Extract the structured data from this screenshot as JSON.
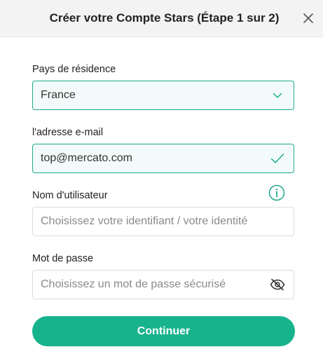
{
  "header": {
    "title": "Créer votre Compte Stars (Étape 1 sur 2)"
  },
  "form": {
    "country": {
      "label": "Pays de résidence",
      "value": "France"
    },
    "email": {
      "label": "l'adresse e-mail",
      "value": "top@mercato.com"
    },
    "username": {
      "label": "Nom d'utilisateur",
      "placeholder": "Choisissez votre identifiant / votre identité",
      "value": ""
    },
    "password": {
      "label": "Mot de passe",
      "placeholder": "Choisissez un mot de passe sécurisé",
      "value": ""
    }
  },
  "actions": {
    "continue_label": "Continuer"
  },
  "icons": {
    "close": "close-icon",
    "dropdown": "chevron-down-icon",
    "valid": "checkmark-icon",
    "info": "info-icon",
    "password_toggle": "eye-slash-icon"
  },
  "colors": {
    "accent": "#17b38d",
    "active_border": "#1fa98d",
    "active_background": "#f3fbfa",
    "header_background": "#f3f3f3"
  }
}
